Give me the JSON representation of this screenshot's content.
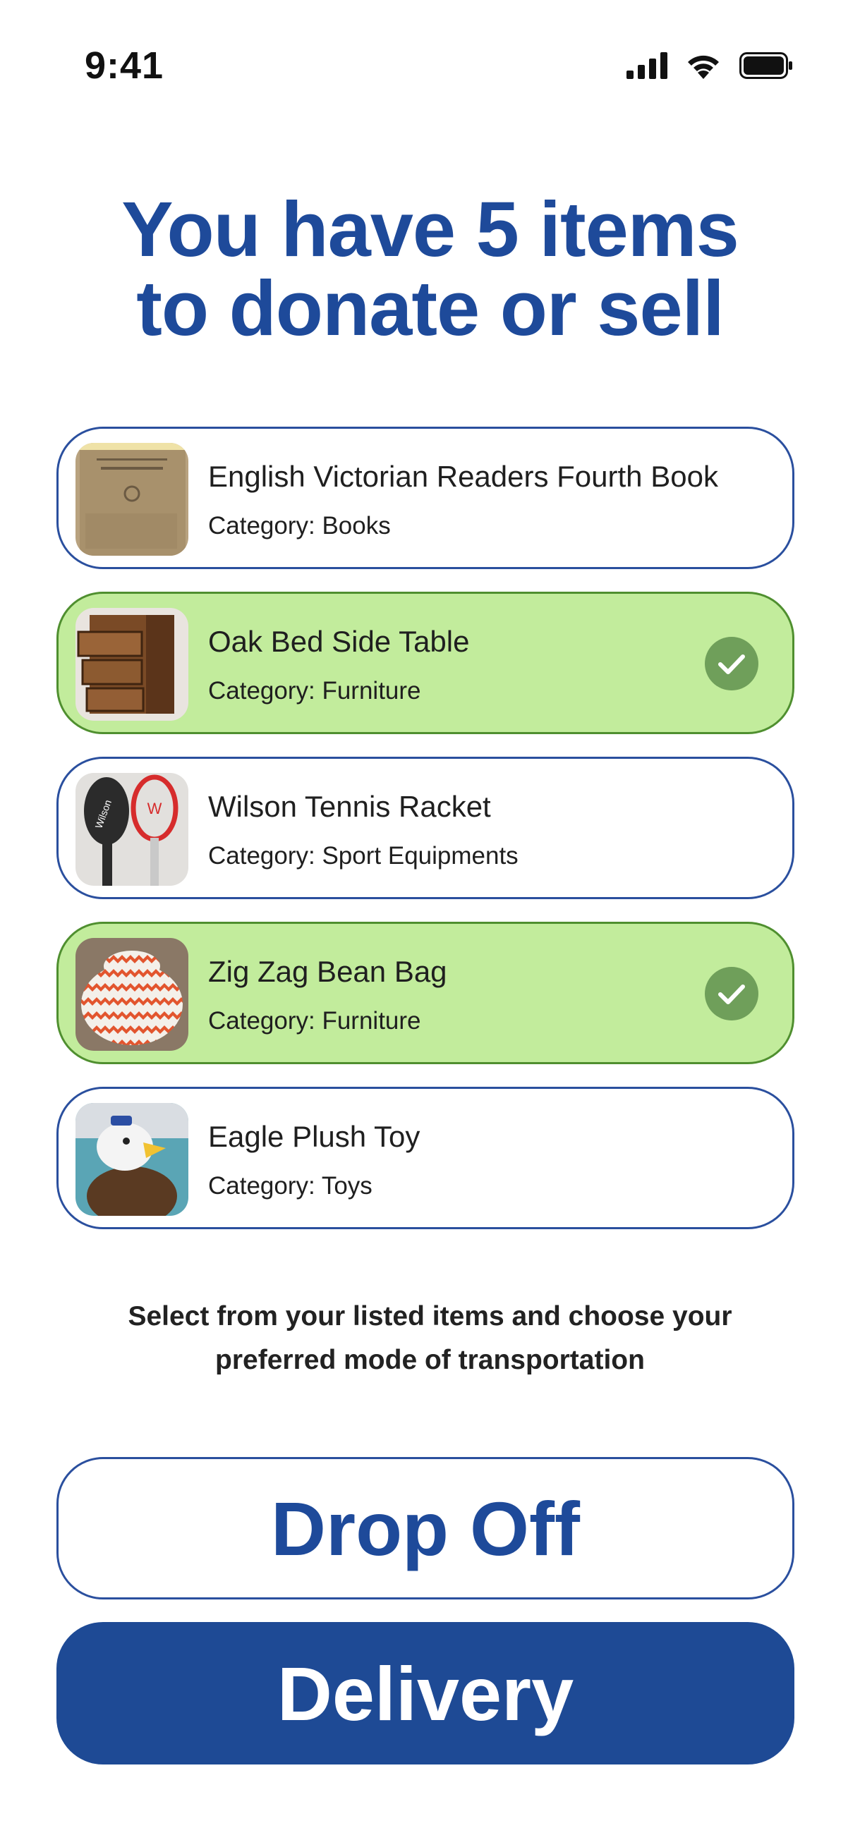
{
  "status_bar": {
    "time": "9:41",
    "icons": [
      "cellular-signal-icon",
      "wifi-icon",
      "battery-icon"
    ]
  },
  "header": {
    "title_line1": "You have 5 items",
    "title_line2": "to donate or sell"
  },
  "items": [
    {
      "name": "English Victorian Readers Fourth Book",
      "category": "Category: Books",
      "selected": false,
      "thumb_icon": "book-photo"
    },
    {
      "name": "Oak Bed Side Table",
      "category": "Category: Furniture",
      "selected": true,
      "thumb_icon": "bedside-table-photo"
    },
    {
      "name": "Wilson Tennis Racket",
      "category": "Category: Sport Equipments",
      "selected": false,
      "thumb_icon": "tennis-racket-photo"
    },
    {
      "name": "Zig Zag Bean Bag",
      "category": "Category: Furniture",
      "selected": true,
      "thumb_icon": "bean-bag-photo"
    },
    {
      "name": "Eagle Plush Toy",
      "category": "Category: Toys",
      "selected": false,
      "thumb_icon": "eagle-plush-photo"
    }
  ],
  "instruction": {
    "line1": "Select from your listed items and choose your",
    "line2": "preferred mode of transportation"
  },
  "actions": {
    "drop_off_label": "Drop Off",
    "delivery_label": "Delivery"
  },
  "colors": {
    "brand_blue": "#1e4a9a",
    "selected_green": "#c2ec9c",
    "check_green": "#6f9f5a"
  }
}
